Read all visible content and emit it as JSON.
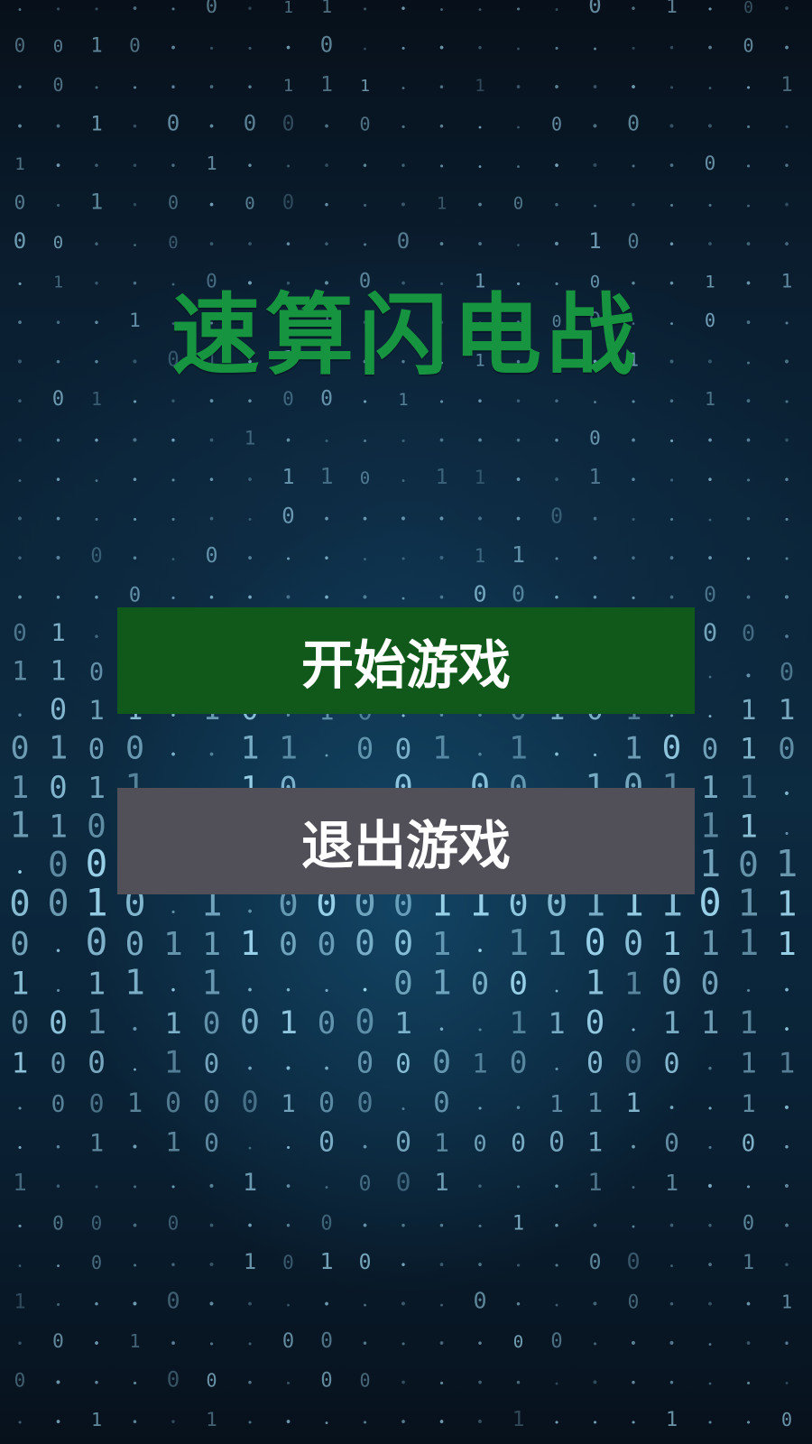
{
  "title": "速算闪电战",
  "menu": {
    "start_label": "开始游戏",
    "exit_label": "退出游戏"
  },
  "background": {
    "glyphs": [
      "0",
      "1"
    ]
  },
  "colors": {
    "title": "#17943f",
    "start_button": "#11591a",
    "exit_button": "#514f57",
    "button_text": "#ffffff",
    "rain_glyph": "#9fd8f0"
  }
}
